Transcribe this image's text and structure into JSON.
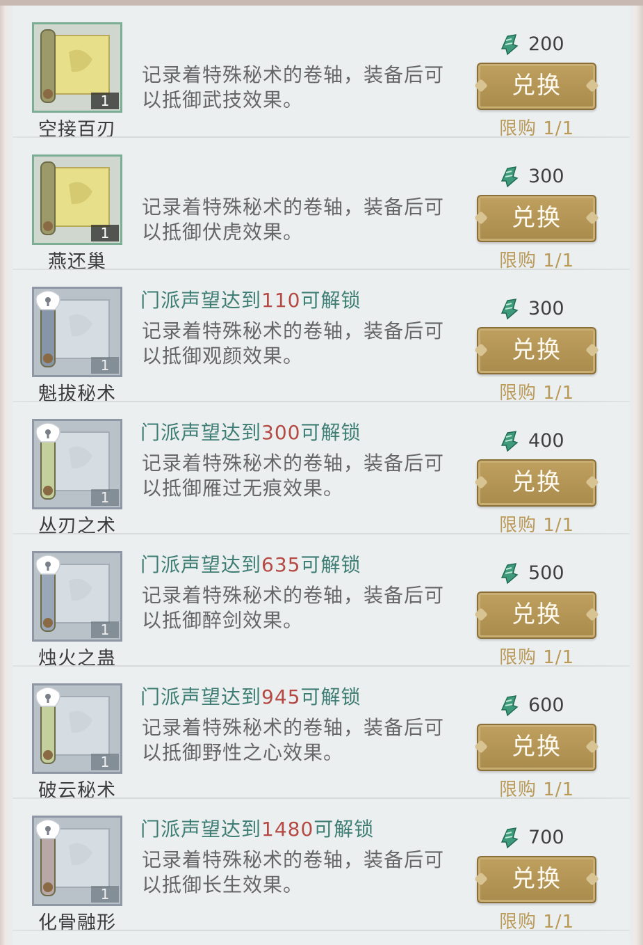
{
  "colors": {
    "accent_gold": "#b99a58",
    "button_gold": "#bfa05f",
    "unlock_text": "#3d7d74",
    "unlock_number": "#b54a44",
    "unlocked_border": "#7cae95",
    "locked_border": "#8e97a3"
  },
  "icons": {
    "currency": "jade-token-icon",
    "locked": "lock-icon",
    "item": "scroll-icon"
  },
  "items": [
    {
      "name": "空接百刃",
      "locked": false,
      "unlock_prefix": "",
      "unlock_value": "",
      "unlock_suffix": "",
      "desc": "记录着特殊秘术的卷轴，装备后可以抵御武技效果。",
      "price": "200",
      "button": "兑换",
      "limit": "限购 1/1",
      "qty": "1"
    },
    {
      "name": "燕还巢",
      "locked": false,
      "unlock_prefix": "",
      "unlock_value": "",
      "unlock_suffix": "",
      "desc": "记录着特殊秘术的卷轴，装备后可以抵御伏虎效果。",
      "price": "300",
      "button": "兑换",
      "limit": "限购 1/1",
      "qty": "1"
    },
    {
      "name": "魁拔秘术",
      "locked": true,
      "unlock_prefix": "门派声望达到",
      "unlock_value": "110",
      "unlock_suffix": "可解锁",
      "desc": "记录着特殊秘术的卷轴，装备后可以抵御观颜效果。",
      "price": "300",
      "button": "兑换",
      "limit": "限购 1/1",
      "qty": "1"
    },
    {
      "name": "丛刃之术",
      "locked": true,
      "unlock_prefix": "门派声望达到",
      "unlock_value": "300",
      "unlock_suffix": "可解锁",
      "desc": "记录着特殊秘术的卷轴，装备后可以抵御雁过无痕效果。",
      "price": "400",
      "button": "兑换",
      "limit": "限购 1/1",
      "qty": "1"
    },
    {
      "name": "烛火之蛊",
      "locked": true,
      "unlock_prefix": "门派声望达到",
      "unlock_value": "635",
      "unlock_suffix": "可解锁",
      "desc": "记录着特殊秘术的卷轴，装备后可以抵御醉剑效果。",
      "price": "500",
      "button": "兑换",
      "limit": "限购 1/1",
      "qty": "1"
    },
    {
      "name": "破云秘术",
      "locked": true,
      "unlock_prefix": "门派声望达到",
      "unlock_value": "945",
      "unlock_suffix": "可解锁",
      "desc": "记录着特殊秘术的卷轴，装备后可以抵御野性之心效果。",
      "price": "600",
      "button": "兑换",
      "limit": "限购 1/1",
      "qty": "1"
    },
    {
      "name": "化骨融形",
      "locked": true,
      "unlock_prefix": "门派声望达到",
      "unlock_value": "1480",
      "unlock_suffix": "可解锁",
      "desc": "记录着特殊秘术的卷轴，装备后可以抵御长生效果。",
      "price": "700",
      "button": "兑换",
      "limit": "限购 1/1",
      "qty": "1"
    }
  ]
}
